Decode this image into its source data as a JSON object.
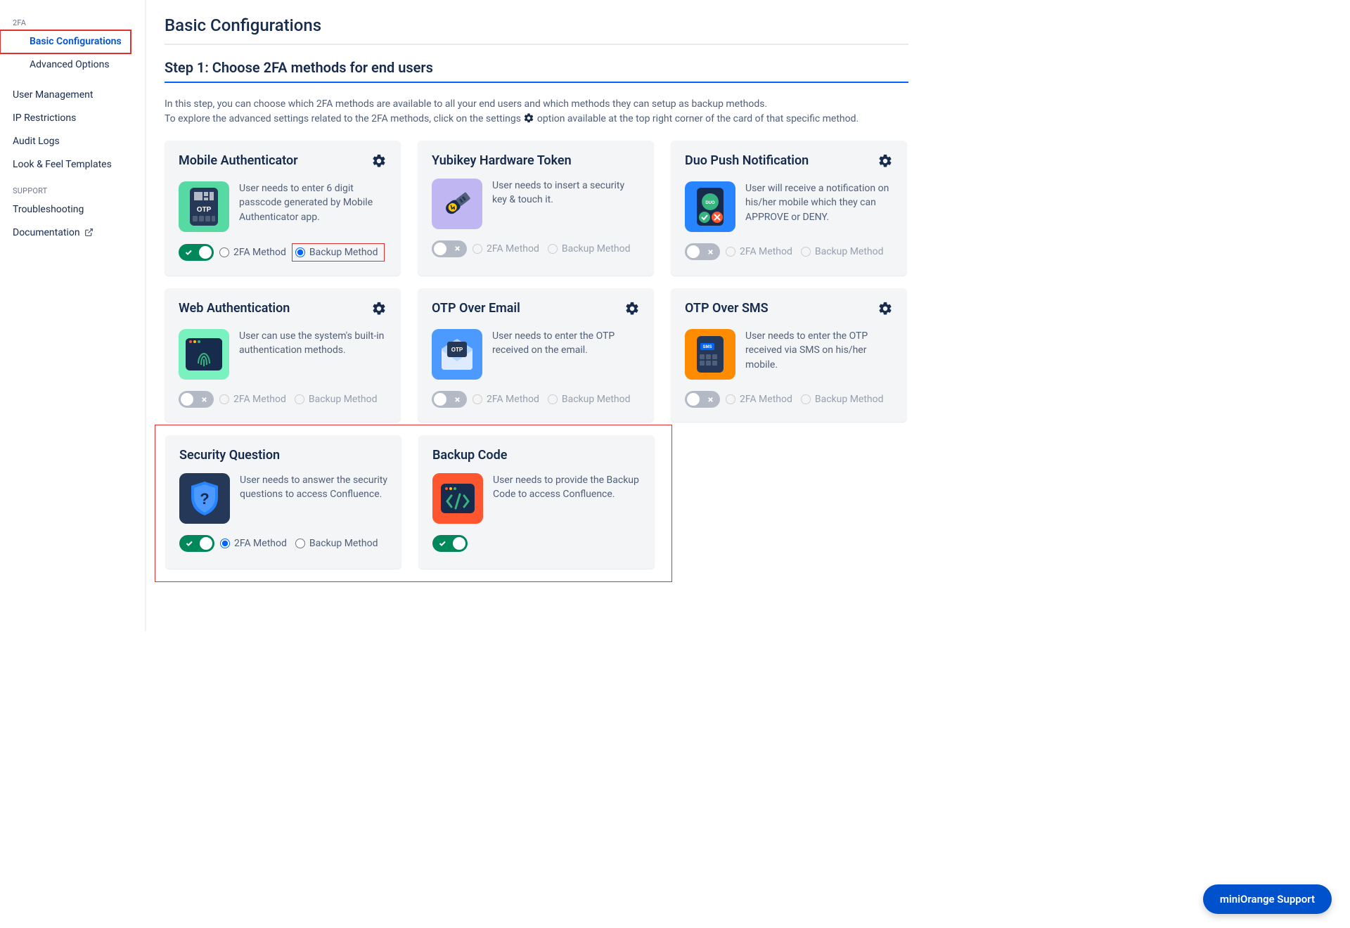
{
  "sidebar": {
    "sections": [
      {
        "title": "2FA",
        "items": [
          "Basic Configurations",
          "Advanced Options"
        ]
      },
      {
        "items": [
          "User Management",
          "IP Restrictions",
          "Audit Logs",
          "Look & Feel Templates"
        ]
      },
      {
        "title": "SUPPORT",
        "items": [
          "Troubleshooting",
          "Documentation"
        ]
      }
    ]
  },
  "page": {
    "title": "Basic Configurations",
    "step_title": "Step 1: Choose 2FA methods for end users",
    "intro_line1": "In this step, you can choose which 2FA methods are available to all your end users and which methods they can setup as backup methods.",
    "intro_prefix": "To explore the advanced settings related to the 2FA methods, click on the settings ",
    "intro_suffix": " option available at the top right corner of the card of that specific method."
  },
  "labels": {
    "tfa": "2FA Method",
    "backup": "Backup Method"
  },
  "cards": [
    {
      "title": "Mobile Authenticator",
      "desc": "User needs to enter 6 digit passcode generated by Mobile Authenticator app.",
      "enabled": true,
      "has_gear": true,
      "selected": "backup"
    },
    {
      "title": "Yubikey Hardware Token",
      "desc": "User needs to insert a security key & touch it.",
      "enabled": false,
      "has_gear": false
    },
    {
      "title": "Duo Push Notification",
      "desc": "User will receive a notification on his/her mobile which they can APPROVE or DENY.",
      "enabled": false,
      "has_gear": true
    },
    {
      "title": "Web Authentication",
      "desc": "User can use the system's built-in authentication methods.",
      "enabled": false,
      "has_gear": true
    },
    {
      "title": "OTP Over Email",
      "desc": "User needs to enter the OTP received on the email.",
      "enabled": false,
      "has_gear": true
    },
    {
      "title": "OTP Over SMS",
      "desc": "User needs to enter the OTP received via SMS on his/her mobile.",
      "enabled": false,
      "has_gear": true
    },
    {
      "title": "Security Question",
      "desc": "User needs to answer the security questions to access Confluence.",
      "enabled": true,
      "has_gear": false,
      "selected": "tfa"
    },
    {
      "title": "Backup Code",
      "desc": "User needs to provide the Backup Code to access Confluence.",
      "enabled": true,
      "has_gear": false,
      "no_radios": true
    }
  ],
  "support_button": "miniOrange Support"
}
